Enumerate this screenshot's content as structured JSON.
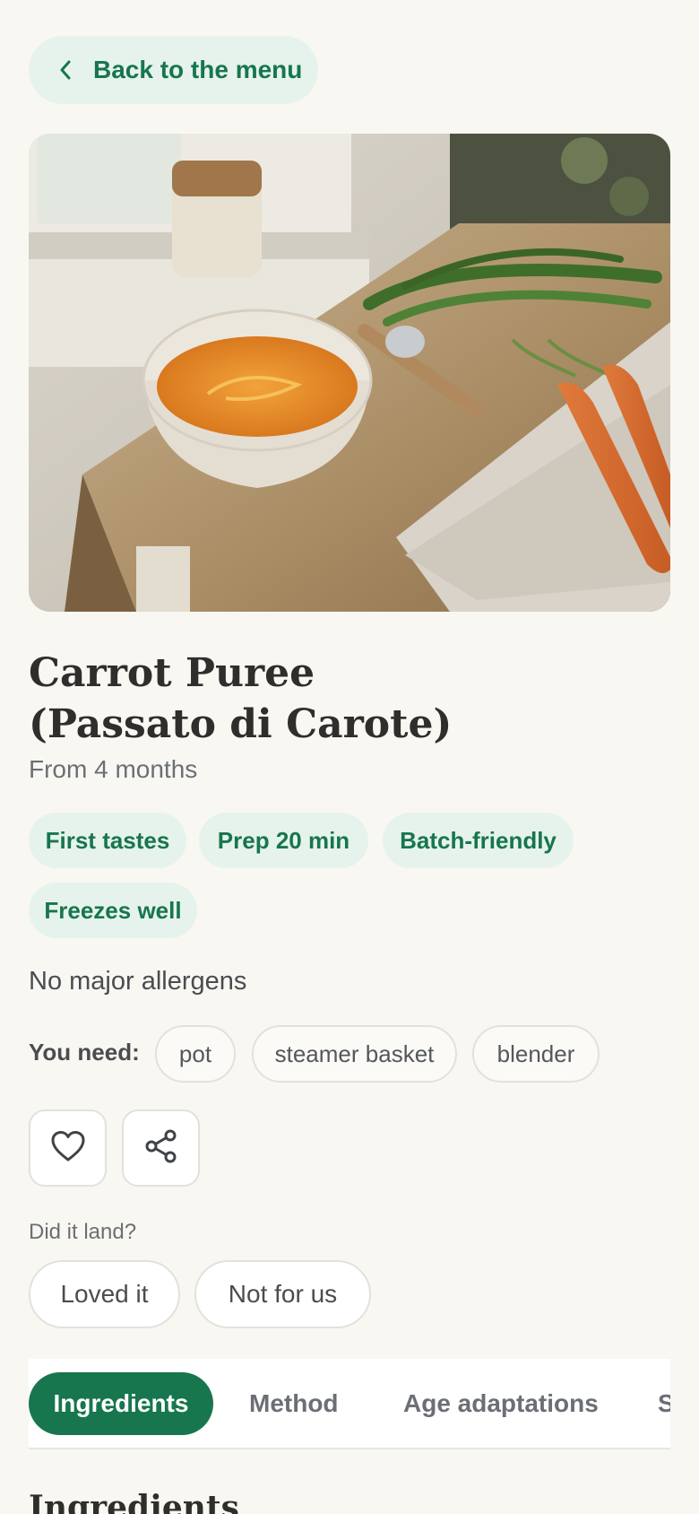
{
  "back": {
    "label": "Back to the menu",
    "icon": "chevron-left-icon"
  },
  "hero": {
    "alt": "Carrot puree in a speckled bowl on a wooden table with fresh carrots"
  },
  "recipe": {
    "title_line1": "Carrot Puree",
    "title_line2": "(Passato di Carote)",
    "age": "From 4 months",
    "tags": [
      "First tastes",
      "Prep 20 min",
      "Batch-friendly",
      "Freezes well"
    ],
    "allergens": "No major allergens"
  },
  "equipment": {
    "label": "You need:",
    "items": [
      "pot",
      "steamer basket",
      "blender"
    ]
  },
  "actions": {
    "favorite_icon": "heart-icon",
    "share_icon": "share-icon"
  },
  "feedback": {
    "question": "Did it land?",
    "options": [
      "Loved it",
      "Not for us"
    ]
  },
  "tabs": {
    "items": [
      "Ingredients",
      "Method",
      "Age adaptations",
      "S"
    ],
    "active": "Ingredients"
  },
  "section": {
    "heading": "Ingredients"
  },
  "colors": {
    "accent": "#17764d",
    "accent_soft": "#e6f3ec",
    "background": "#f9f7f2",
    "text": "#2f2e2c"
  }
}
